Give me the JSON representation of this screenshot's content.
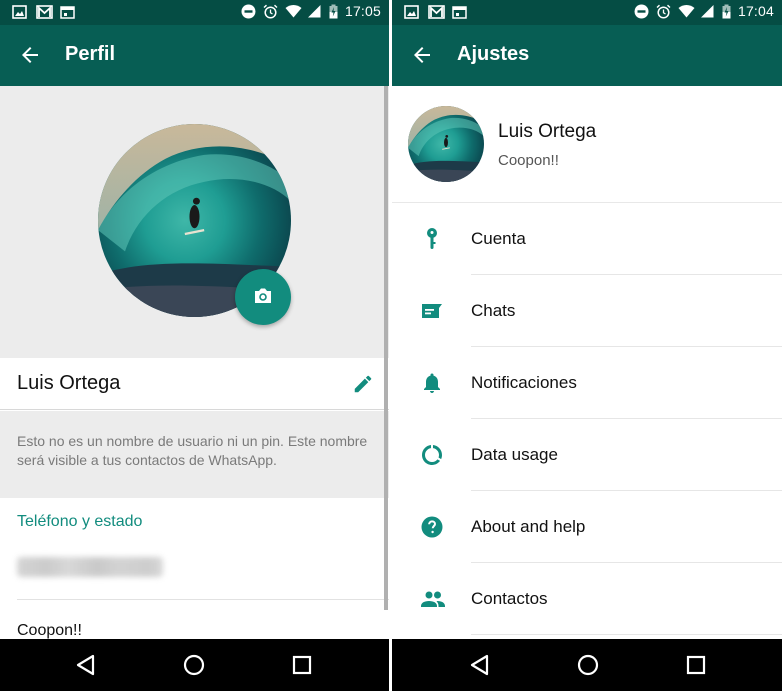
{
  "colors": {
    "statusbar": "#054d44",
    "appbar": "#075e54",
    "accent": "#128c7e"
  },
  "left_screen": {
    "statusbar": {
      "left_icons": [
        "image-icon",
        "gmail-icon",
        "calendar-icon"
      ],
      "right_icons": [
        "do-not-disturb-icon",
        "alarm-icon",
        "wifi-icon",
        "signal-icon",
        "battery-charging-icon"
      ],
      "time": "17:05"
    },
    "appbar": {
      "back_icon": "arrow-back-icon",
      "title": "Perfil"
    },
    "profile": {
      "photo_alt": "surfer-in-wave-photo",
      "camera_icon": "camera-icon",
      "name": "Luis Ortega",
      "edit_icon": "pencil-icon",
      "hint": "Esto no es un nombre de usuario ni un pin. Este nombre será visible a tus contactos de WhatsApp.",
      "section_header": "Teléfono y estado",
      "phone_number_blurred": true,
      "status": "Coopon!!"
    },
    "navbar": [
      "back-nav-icon",
      "home-nav-icon",
      "recents-nav-icon"
    ]
  },
  "right_screen": {
    "statusbar": {
      "left_icons": [
        "image-icon",
        "gmail-icon",
        "calendar-icon"
      ],
      "right_icons": [
        "do-not-disturb-icon",
        "alarm-icon",
        "wifi-icon",
        "signal-icon",
        "battery-charging-icon"
      ],
      "time": "17:04"
    },
    "appbar": {
      "back_icon": "arrow-back-icon",
      "title": "Ajustes"
    },
    "profile_card": {
      "name": "Luis Ortega",
      "status": "Coopon!!"
    },
    "settings": [
      {
        "label": "Cuenta",
        "icon": "key-icon"
      },
      {
        "label": "Chats",
        "icon": "chat-icon"
      },
      {
        "label": "Notificaciones",
        "icon": "bell-icon"
      },
      {
        "label": "Data usage",
        "icon": "data-usage-icon"
      },
      {
        "label": "About and help",
        "icon": "help-icon"
      },
      {
        "label": "Contactos",
        "icon": "contacts-icon"
      }
    ],
    "navbar": [
      "back-nav-icon",
      "home-nav-icon",
      "recents-nav-icon"
    ]
  }
}
